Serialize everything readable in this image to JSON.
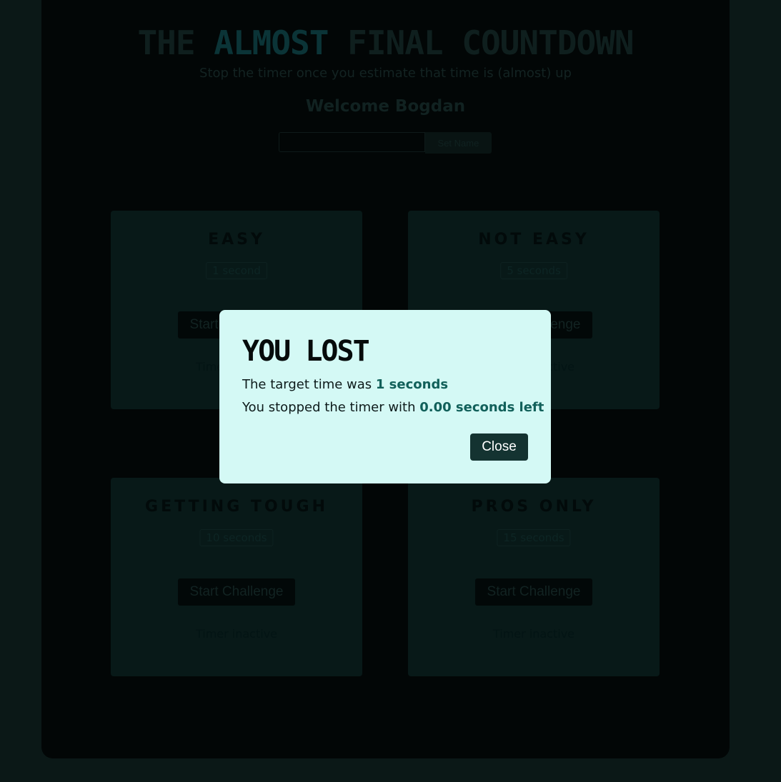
{
  "header": {
    "title_pre": "THE",
    "title_accent": "ALMOST",
    "title_post": "FINAL COUNTDOWN",
    "subtitle": "Stop the timer once you estimate that time is (almost) up",
    "welcome": "Welcome Bogdan",
    "name_input_value": "",
    "set_name_label": "Set Name"
  },
  "challenges": [
    {
      "title": "EASY",
      "duration": "1 second",
      "button": "Start Challenge",
      "status": "Timer inactive"
    },
    {
      "title": "NOT EASY",
      "duration": "5 seconds",
      "button": "Start Challenge",
      "status": "Timer inactive"
    },
    {
      "title": "GETTING TOUGH",
      "duration": "10 seconds",
      "button": "Start Challenge",
      "status": "Timer inactive"
    },
    {
      "title": "PROS ONLY",
      "duration": "15 seconds",
      "button": "Start Challenge",
      "status": "Timer inactive"
    }
  ],
  "modal": {
    "title": "YOU LOST",
    "target_prefix": "The target time was ",
    "target_value": "1 seconds",
    "stopped_prefix": "You stopped the timer with ",
    "stopped_value": "0.00 seconds left",
    "close_label": "Close"
  },
  "colors": {
    "accent": "#11605a",
    "modal_bg": "#d4f9f5",
    "close_btn": "#143331"
  }
}
